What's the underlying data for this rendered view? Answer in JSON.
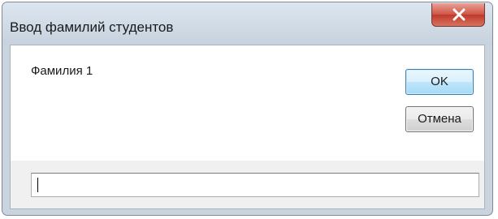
{
  "dialog": {
    "title": "Ввод фамилий студентов",
    "prompt": "Фамилия 1",
    "ok_label": "OK",
    "cancel_label": "Отмена",
    "input_value": "",
    "close_icon": "close-icon"
  },
  "colors": {
    "frame": "#c9d4df",
    "close_button": "#c0392b",
    "ok_border": "#3c7fb1",
    "client_bg": "#ffffff",
    "band_bg": "#f0f0f0"
  }
}
